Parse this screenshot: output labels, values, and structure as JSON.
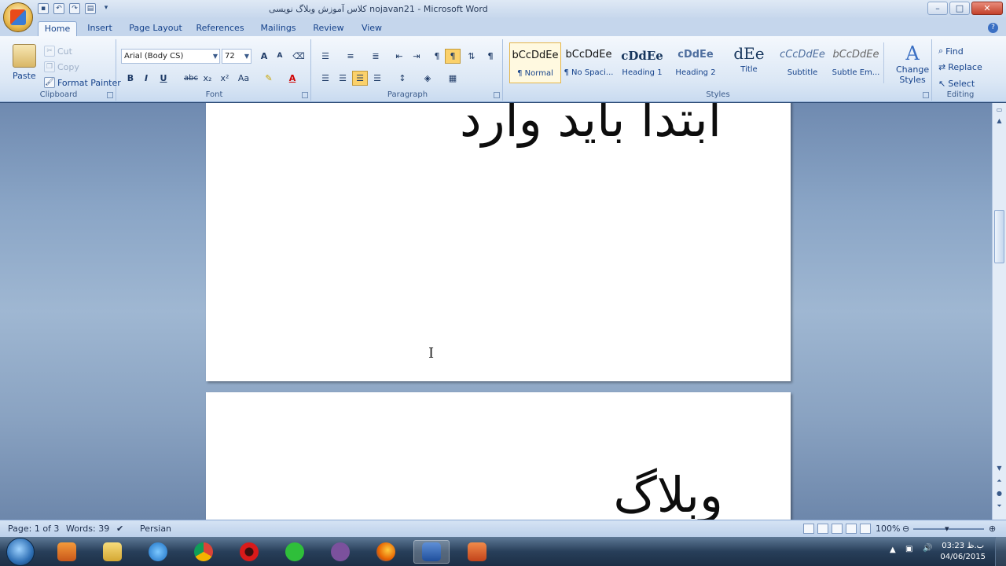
{
  "window": {
    "title": "کلاس آموزش وبلاگ نویسی nojavan21 - Microsoft Word",
    "minimize": "–",
    "maximize": "□",
    "close": "✕"
  },
  "tabs": [
    "Home",
    "Insert",
    "Page Layout",
    "References",
    "Mailings",
    "Review",
    "View"
  ],
  "clipboard": {
    "paste": "Paste",
    "cut": "Cut",
    "copy": "Copy",
    "format_painter": "Format Painter",
    "label": "Clipboard"
  },
  "font": {
    "name": "Arial (Body CS)",
    "size": "72",
    "label": "Font",
    "bold": "B",
    "italic": "I",
    "underline": "U",
    "strike": "abc",
    "subscript": "x₂",
    "superscript": "x²",
    "change_case": "Aa"
  },
  "paragraph": {
    "label": "Paragraph",
    "pilcrow": "¶"
  },
  "styles": {
    "label": "Styles",
    "items": [
      {
        "preview": "bCcDdEe",
        "name": "¶ Normal"
      },
      {
        "preview": "bCcDdEe",
        "name": "¶ No Spaci..."
      },
      {
        "preview": "cDdEe",
        "name": "Heading 1"
      },
      {
        "preview": "cDdEe",
        "name": "Heading 2"
      },
      {
        "preview": "dEe",
        "name": "Title"
      },
      {
        "preview": "cCcDdEe",
        "name": "Subtitle"
      },
      {
        "preview": "bCcDdEe",
        "name": "Subtle Em..."
      }
    ],
    "change_styles_1": "Change",
    "change_styles_2": "Styles"
  },
  "editing": {
    "find": "Find",
    "replace": "Replace",
    "select": "Select",
    "label": "Editing"
  },
  "document": {
    "page1_text": "ابتدا باید وارد",
    "page2_text": "وبلاگ"
  },
  "status": {
    "page": "Page: 1 of 3",
    "words": "Words: 39",
    "language": "Persian",
    "zoom": "100%"
  },
  "taskbar": {
    "time": "03:23 ب.ظ",
    "date": "04/06/2015"
  },
  "colors": {
    "ribbon_bg": "#dbe7f5",
    "accent": "#15428b",
    "highlight": "#fbd16b"
  }
}
